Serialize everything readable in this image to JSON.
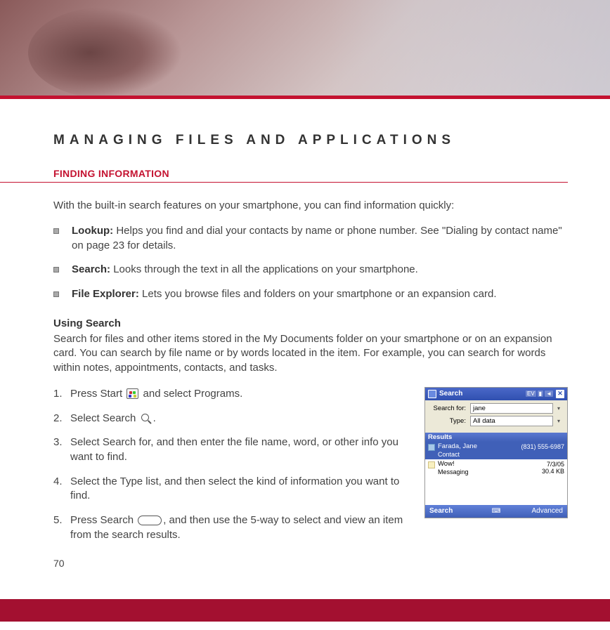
{
  "page_title": "MANAGING FILES AND APPLICATIONS",
  "section_heading": "FINDING INFORMATION",
  "intro": "With the built-in search features on your smartphone, you can find information quickly:",
  "bullets": [
    {
      "label": "Lookup:",
      "text": " Helps you find and dial your contacts by name or phone number. See \"Dialing by contact name\" on page 23 for details."
    },
    {
      "label": "Search:",
      "text": " Looks through the text in all the applications on your smartphone."
    },
    {
      "label": "File Explorer:",
      "text": " Lets you browse files and folders on your smartphone or an expansion card."
    }
  ],
  "subheading": "Using Search",
  "sub_para": "Search for files and other items stored in the My Documents folder on your smartphone or on an expansion card. You can search by file name or by words located in the item. For example, you can search for words within notes, appointments, contacts, and tasks.",
  "steps": [
    {
      "num": "1.",
      "pre": "Press Start ",
      "post": " and select Programs.",
      "icon": "start"
    },
    {
      "num": "2.",
      "pre": "Select Search ",
      "post": ".",
      "icon": "search"
    },
    {
      "num": "3.",
      "pre": "Select Search for, and then enter the file name, word, or other info you want to find.",
      "post": "",
      "icon": null
    },
    {
      "num": "4.",
      "pre": "Select the Type list, and then select the kind of information you want to find.",
      "post": "",
      "icon": null
    },
    {
      "num": "5.",
      "pre": "Press Search ",
      "post": ", and then use the 5-way to select and view an item from the search results.",
      "icon": "softkey"
    }
  ],
  "page_number": "70",
  "screenshot": {
    "title": "Search",
    "status_icons": [
      "EV",
      "📶",
      "🔊"
    ],
    "search_for_label": "Search for:",
    "search_for_value": "jane",
    "type_label": "Type:",
    "type_value": "All data",
    "results_header": "Results",
    "results": [
      {
        "icon": "contact",
        "name": "Farada, Jane",
        "sub": "Contact",
        "meta1": "",
        "meta2": "(831) 555-6987",
        "selected": true
      },
      {
        "icon": "msg",
        "name": "Wow!",
        "sub": "Messaging",
        "meta1": "7/3/05",
        "meta2": "30.4 KB",
        "selected": false
      }
    ],
    "softkey_left": "Search",
    "softkey_right": "Advanced"
  }
}
